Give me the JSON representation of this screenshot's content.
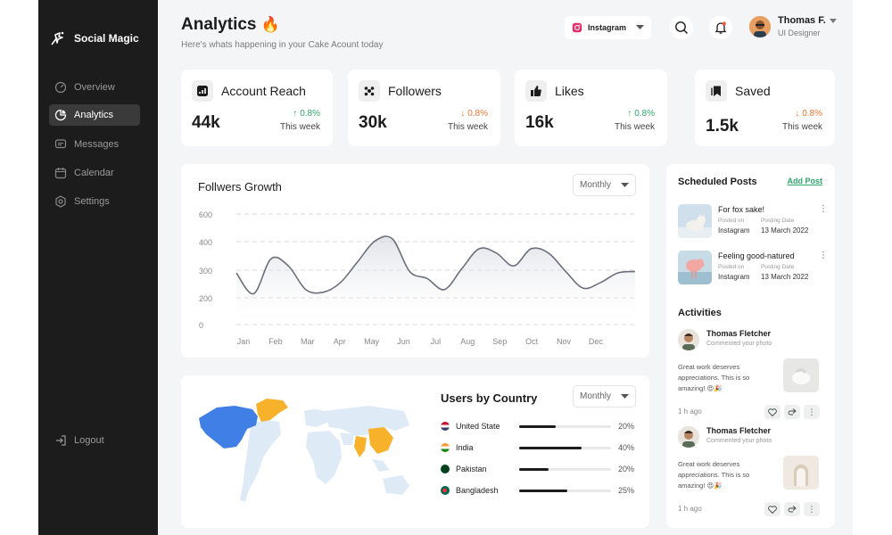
{
  "colors": {
    "sidebar_bg": "#1c1c1c",
    "accent_green": "#2ea86b",
    "accent_orange": "#f07532",
    "map_blue": "#3f7fe6",
    "map_orange": "#f8b12a",
    "map_land": "#dfeaf7"
  },
  "sidebar": {
    "brand": "Social Magic",
    "items": [
      {
        "label": "Overview",
        "icon": "overview-icon",
        "active": false
      },
      {
        "label": "Analytics",
        "icon": "analytics-icon",
        "active": true
      },
      {
        "label": "Messages",
        "icon": "messages-icon",
        "active": false
      },
      {
        "label": "Calendar",
        "icon": "calendar-icon",
        "active": false
      },
      {
        "label": "Settings",
        "icon": "settings-icon",
        "active": false
      }
    ],
    "logout": "Logout"
  },
  "header": {
    "title": "Analytics",
    "title_emoji": "🔥",
    "subtitle": "Here's whats happening in your Cake Acount today",
    "platform": "Instagram",
    "user_name": "Thomas F.",
    "user_role": "UI Designer"
  },
  "stats": [
    {
      "title": "Account Reach",
      "value": "44k",
      "change": "0.8%",
      "direction": "up",
      "period": "This week",
      "icon": "chart-icon"
    },
    {
      "title": "Followers",
      "value": "30k",
      "change": "0.8%",
      "direction": "down",
      "period": "This week",
      "icon": "followers-icon"
    },
    {
      "title": "Likes",
      "value": "16k",
      "change": "0.8%",
      "direction": "up",
      "period": "This week",
      "icon": "thumbs-up-icon"
    },
    {
      "title": "Saved",
      "value": "1.5k",
      "change": "0.8%",
      "direction": "down",
      "period": "This week",
      "icon": "bookmark-icon"
    }
  ],
  "growth": {
    "title": "Follwers Growth",
    "period": "Monthly"
  },
  "chart_data": {
    "type": "area",
    "title": "Follwers Growth",
    "xlabel": "",
    "ylabel": "",
    "ylim": [
      0,
      600
    ],
    "yticks": [
      "600",
      "400",
      "300",
      "200",
      "0"
    ],
    "categories": [
      "Jan",
      "Feb",
      "Mar",
      "Apr",
      "May",
      "Jun",
      "Jul",
      "Aug",
      "Sep",
      "Oct",
      "Nov",
      "Dec"
    ],
    "x": [
      0,
      0.5,
      1,
      1.5,
      2,
      2.5,
      3,
      3.5,
      4,
      4.5,
      5,
      5.5,
      6,
      6.5,
      7,
      7.5,
      8,
      8.5,
      9,
      9.5,
      10,
      10.5,
      11,
      11.5
    ],
    "values": [
      290,
      215,
      340,
      315,
      230,
      220,
      255,
      330,
      405,
      420,
      295,
      270,
      230,
      305,
      375,
      360,
      315,
      375,
      360,
      295,
      235,
      255,
      290,
      295
    ]
  },
  "countries": {
    "title": "Users by Country",
    "period": "Monthly",
    "rows": [
      {
        "name": "United State",
        "pct": "20%",
        "value": 0.4,
        "flag": "#c8102e"
      },
      {
        "name": "India",
        "pct": "40%",
        "value": 0.68,
        "flag": "#ff9933"
      },
      {
        "name": "Pakistan",
        "pct": "20%",
        "value": 0.32,
        "flag": "#01411c"
      },
      {
        "name": "Bangladesh",
        "pct": "25%",
        "value": 0.52,
        "flag": "#006a4e"
      }
    ]
  },
  "scheduled": {
    "title": "Scheduled Posts",
    "add_label": "Add Post",
    "posted_on_label": "Posted on",
    "posting_date_label": "Posting Date",
    "posts": [
      {
        "title": "For fox sake!",
        "platform": "Instagram",
        "date": "13 March 2022"
      },
      {
        "title": "Feeling good-natured",
        "platform": "Instagram",
        "date": "13 March 2022"
      }
    ]
  },
  "activities": {
    "title": "Activities",
    "items": [
      {
        "name": "Thomas Fletcher",
        "action": "Commented your photo",
        "comment": "Great work deserves appreciations. This is so amazing! 😍🎉",
        "time": "1 h ago"
      },
      {
        "name": "Thomas Fletcher",
        "action": "Commented your photo",
        "comment": "Great work deserves appreciations. This is so amazing! 😍🎉",
        "time": "1 h ago"
      }
    ]
  }
}
